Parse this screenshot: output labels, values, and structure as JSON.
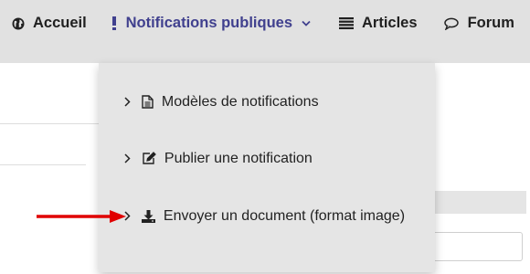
{
  "nav": {
    "items": [
      {
        "label": "Accueil",
        "icon": "globe-icon"
      },
      {
        "label": "Notifications publiques",
        "icon": "exclamation-icon",
        "active": true,
        "dropdown": true
      },
      {
        "label": "Articles",
        "icon": "list-icon"
      },
      {
        "label": "Forum",
        "icon": "comment-icon"
      }
    ]
  },
  "dropdown": {
    "items": [
      {
        "label": "Modèles de notifications",
        "icon": "document-icon"
      },
      {
        "label": "Publier une notification",
        "icon": "edit-icon"
      },
      {
        "label": "Envoyer un document (format image)",
        "icon": "download-icon"
      }
    ]
  },
  "colors": {
    "nav_bg": "#e1e1e1",
    "active": "#40408e",
    "dropdown_bg": "#e5e5e5",
    "arrow": "#e00000"
  }
}
